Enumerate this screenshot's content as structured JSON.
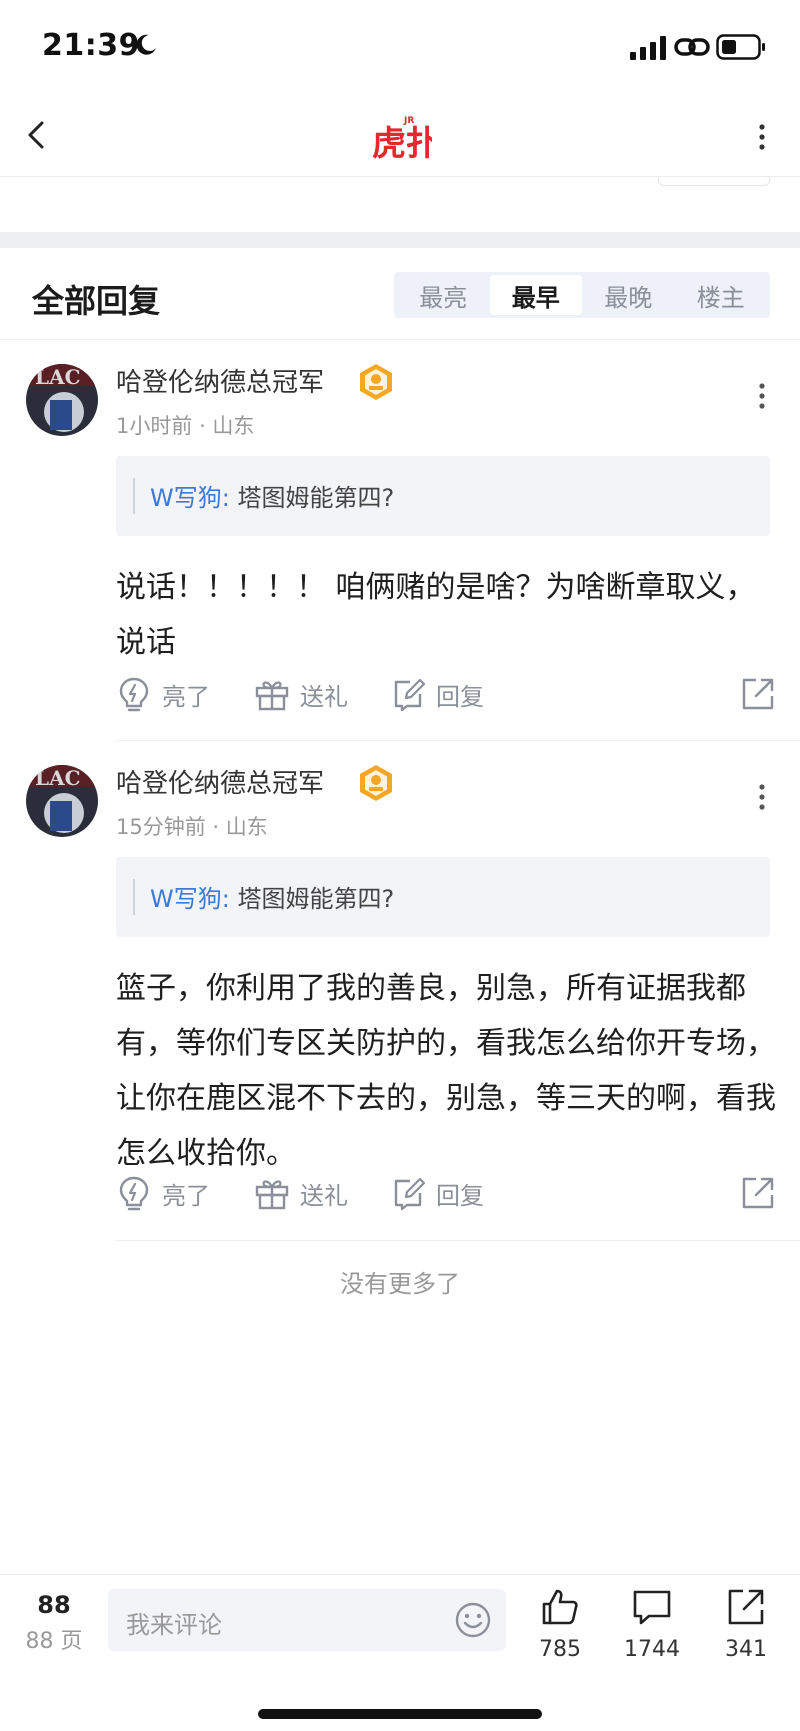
{
  "status_bar": {
    "time": "21:39"
  },
  "nav": {
    "logo_text": "虎扑",
    "logo_sup": "JR"
  },
  "replies": {
    "title": "全部回复",
    "tabs": [
      "最亮",
      "最早",
      "最晚",
      "楼主"
    ],
    "active_tab": "最早"
  },
  "comments": [
    {
      "username": "哈登伦纳德总冠军",
      "time": "1小时前",
      "location": "山东",
      "quote_author": "W写狗",
      "quote_text": "塔图姆能第四?",
      "body": "说话！！！！！ 咱俩赌的是啥？为啥断章取义，说话",
      "actions": {
        "light": "亮了",
        "gift": "送礼",
        "reply": "回复"
      }
    },
    {
      "username": "哈登伦纳德总冠军",
      "time": "15分钟前",
      "location": "山东",
      "quote_author": "W写狗",
      "quote_text": "塔图姆能第四?",
      "body": "篮子，你利用了我的善良，别急，所有证据我都有，等你们专区关防护的，看我怎么给你开专场，让你在鹿区混不下去的，别急，等三天的啊，看我怎么收拾你。",
      "actions": {
        "light": "亮了",
        "gift": "送礼",
        "reply": "回复"
      }
    }
  ],
  "no_more": "没有更多了",
  "bottom_bar": {
    "page_number": "88",
    "page_label": "88 页",
    "comment_placeholder": "我来评论",
    "likes": "785",
    "comments": "1744",
    "shares": "341"
  },
  "colors": {
    "accent_blue": "#3d7ad8",
    "logo_red": "#e8262d",
    "badge_orange": "#f5a623"
  }
}
